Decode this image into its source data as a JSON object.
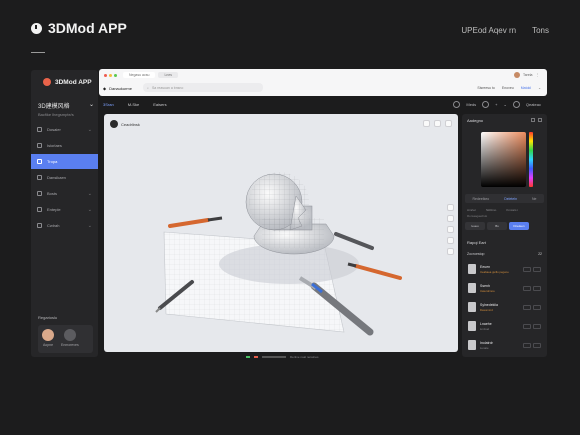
{
  "header": {
    "title": "3DMod APP",
    "right_links": [
      "UPEod Aqev rn",
      "Tons"
    ]
  },
  "sidebar": {
    "brand": "3DMod APP",
    "project_title": "3D建模风格",
    "project_sub": "Bacfike lhegsmpte/s",
    "items": [
      {
        "label": "Dosaier",
        "active": false
      },
      {
        "label": "Isiorlaes",
        "active": false
      },
      {
        "label": "Tropa",
        "active": true
      },
      {
        "label": "Dansikaen",
        "active": false
      },
      {
        "label": "Bosts",
        "active": false
      },
      {
        "label": "Enteple",
        "active": false
      },
      {
        "label": "Cwlrah",
        "active": false
      }
    ],
    "recent_title": "Regarioslu",
    "recent_users": [
      "Aopne",
      "Enmoreves"
    ]
  },
  "browser": {
    "tabs": [
      "Negasu acsu",
      "Lnes"
    ],
    "user_name": "Tarela",
    "logo_text": "Danaukurme",
    "search_placeholder": "Sa reasuan a bnsno",
    "nav_links": [
      "Sisreesu to",
      "Enoveu",
      "Matokl"
    ]
  },
  "toolbar": {
    "tabs": [
      "3Sran",
      "M-Ske",
      "Eaisers"
    ],
    "mode_label": "Meds",
    "queue_label": "Qeateac"
  },
  "canvas": {
    "label": "Ceadrlinsk"
  },
  "panel": {
    "title": "Aadegno",
    "tabs": [
      "Redeelkeo",
      "Deleteln",
      "Ne"
    ],
    "checks": [
      "Amrter",
      "Nkbbno",
      "Kmcars i"
    ],
    "sub_note": "Rorsaagaeihuk",
    "segments": [
      "Ieueo",
      "Bs",
      "Dneleen"
    ],
    "list_title": "Rapqi Eart",
    "list_head": "Zocroestop",
    "list_count": "22",
    "layers": [
      {
        "name": "Eeuen",
        "meta": "Ueabaea guillo pegene"
      },
      {
        "name": "Ssenh",
        "meta": "Uaterdcrere"
      },
      {
        "name": "Sylnedekiia",
        "meta": "Dasonnnd"
      },
      {
        "name": "Lnaehe",
        "meta": "Lmzuel"
      },
      {
        "name": "Inolatrdr",
        "meta": "Lunate"
      }
    ]
  },
  "status": {
    "text": "Denlne noal neratnes"
  },
  "colors": {
    "accent": "#5a7ff0",
    "swatch": "#ec8c5e"
  }
}
